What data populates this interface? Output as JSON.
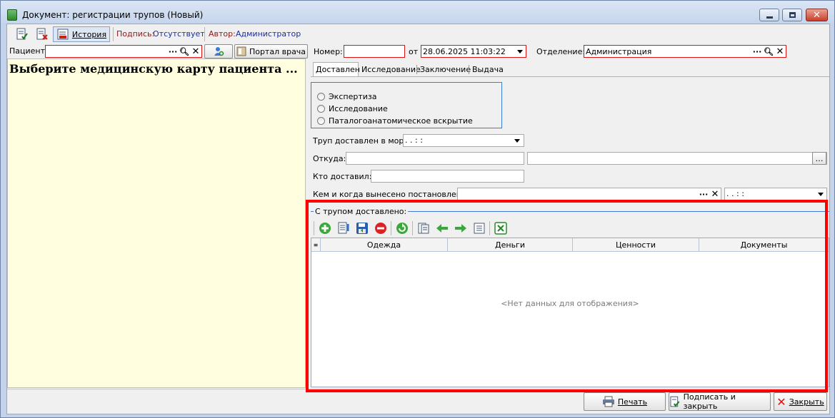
{
  "window": {
    "title": "Документ: регистрации трупов (Новый)"
  },
  "toolbar": {
    "history_label": "История",
    "signature_label": "Подпись:",
    "signature_value": "Отсутствует",
    "author_label": "Автор:",
    "author_value": "Администратор"
  },
  "patient": {
    "label": "Пациент:",
    "value": "",
    "portal_button": "Портал врача",
    "prompt": "Выберите медицинскую карту пациента ..."
  },
  "header": {
    "number_label": "Номер:",
    "number_value": "",
    "date_label": "от",
    "date_value": "28.06.2025 11:03:22",
    "department_label": "Отделение:",
    "department_value": "Администрация"
  },
  "tabs": [
    {
      "label": "Доставлен",
      "active": true
    },
    {
      "label": "Исследование",
      "active": false
    },
    {
      "label": "Заключение",
      "active": false
    },
    {
      "label": "Выдача",
      "active": false
    }
  ],
  "radios": [
    {
      "label": "Экспертиза"
    },
    {
      "label": "Исследование"
    },
    {
      "label": "Паталогоанатомическое вскрытие"
    }
  ],
  "form": {
    "delivered_label": "Труп доставлен в морг:",
    "delivered_value": " .  .      :  :",
    "from_label": "Откуда:",
    "from_value": "",
    "from_value2": "",
    "who_label": "Кто доставил:",
    "who_value": "",
    "decree_label": "Кем и когда вынесено постановление:",
    "decree_value": "",
    "decree_date": " .  .      :  :"
  },
  "items_group": {
    "title": "С трупом доставлено:",
    "columns": [
      "Одежда",
      "Деньги",
      "Ценности",
      "Документы"
    ],
    "empty_text": "<Нет данных для отображения>"
  },
  "footer": {
    "print_label": "Печать",
    "sign_close_label": "Подписать и закрыть",
    "close_label": "Закрыть"
  },
  "colors": {
    "highlight": "#ff0000",
    "left_panel": "#ffffe0",
    "signature_label": "#8b1a1a",
    "signature_value": "#1c2f9a"
  }
}
